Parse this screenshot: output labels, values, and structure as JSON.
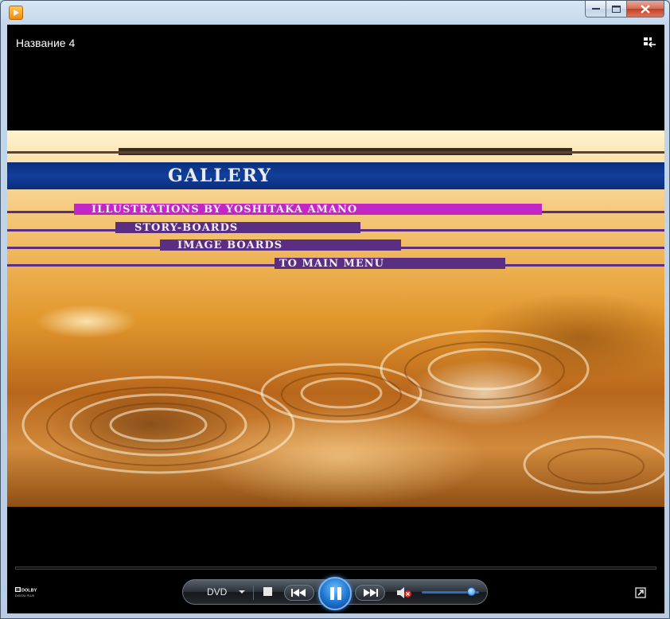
{
  "window": {
    "title_icon": "media-player-icon",
    "controls": [
      "minimize-icon",
      "maximize-icon",
      "close-icon"
    ]
  },
  "now_playing": {
    "caption": "Название 4"
  },
  "dvd_menu": {
    "heading": "GALLERY",
    "items": [
      {
        "label": "ILLUSTRATIONS BY YOSHITAKA AMANO",
        "selected": true
      },
      {
        "label": "STORY-BOARDS",
        "selected": false
      },
      {
        "label": "IMAGE BOARDS",
        "selected": false
      },
      {
        "label": "TO MAIN MENU",
        "selected": false
      }
    ],
    "highlight_color": "#c227c5",
    "item_color": "#5a2f83",
    "band_color": "#123f9b"
  },
  "controls": {
    "dvd_label": "DVD",
    "state": "playing",
    "muted": true,
    "volume_fraction": 0.85,
    "accent": "#1e74d0",
    "icons": [
      "dolby-digital-logo",
      "stop-icon",
      "previous-icon",
      "pause-icon",
      "next-icon",
      "mute-icon",
      "fullscreen-icon",
      "switch-to-library-icon"
    ]
  },
  "dolby_logo_text": "DOLBY DIGITAL PLUS"
}
